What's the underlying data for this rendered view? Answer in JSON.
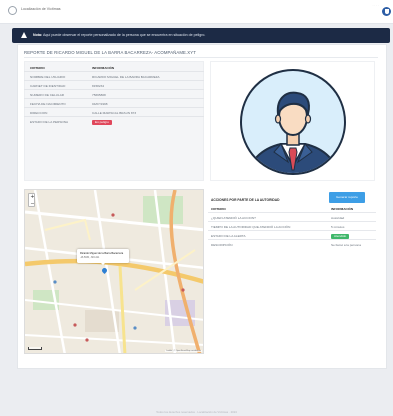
{
  "header": {
    "app_name": "Localización de Víctimas",
    "right_text": "· · · ·"
  },
  "alert": {
    "prefix": "Nota:",
    "text": "Aquí puede observar el reporte personalizado de la persona que se encuentra en situación de peligro."
  },
  "report": {
    "title": "REPORTE DE RICARDO MIGUEL DE LA BARRA BACARREZA- ACOMPAÑAME.XYT",
    "columns": {
      "key": "CRITERIO",
      "value": "INFORMACIÓN"
    },
    "rows": [
      {
        "key": "NOMBRE DEL USUARIO",
        "value": "RICARDO MIGUEL DE LA BARRA BACARREZA"
      },
      {
        "key": "CARNET DE IDENTIDAD",
        "value": "8158234"
      },
      {
        "key": "NUMERO DE CELULAR",
        "value": "75695808"
      },
      {
        "key": "FECHA DE NACIMIENTO",
        "value": "04/07/1998"
      },
      {
        "key": "DIRECCION",
        "value": "CALLE MARISCAL BRAUN 873"
      },
      {
        "key": "ESTADO DE LA PERSONA",
        "value": "En peligro"
      }
    ]
  },
  "map": {
    "zoom_in": "+",
    "zoom_out": "−",
    "popup_title": "Ricardo Miguel de la Barra Bacarreza",
    "popup_sub": "-16.5030, -68.1211",
    "attribution": "Leaflet | © OpenStreetMap contributors"
  },
  "actions": {
    "title": "ACCIONES POR PARTE DE LA AUTORIDAD",
    "export_label": "Generar reporte",
    "columns": {
      "key": "CRITERIO",
      "value": "INFORMACIÓN"
    },
    "rows": [
      {
        "key": "¿QUIEN ATENDIÓ LA ACCION?",
        "value": "Autoridad"
      },
      {
        "key": "TIEMPO DE LA AUTORIDAD QUE ATENDIÓ LA ACCIÓN",
        "value": "5 minutos"
      },
      {
        "key": "ESTADO DE LA ALERTA",
        "value": "Atendido"
      },
      {
        "key": "DESCRIPCIÓN",
        "value": "Se llamó a la persona"
      }
    ]
  },
  "footer": {
    "text": "Todos los derechos reservados · Localización de Víctimas · 2024"
  },
  "colors": {
    "alert_bg": "#1c2a45",
    "danger": "#e0475b",
    "success": "#3fb76a",
    "primary": "#3d9ee6"
  }
}
